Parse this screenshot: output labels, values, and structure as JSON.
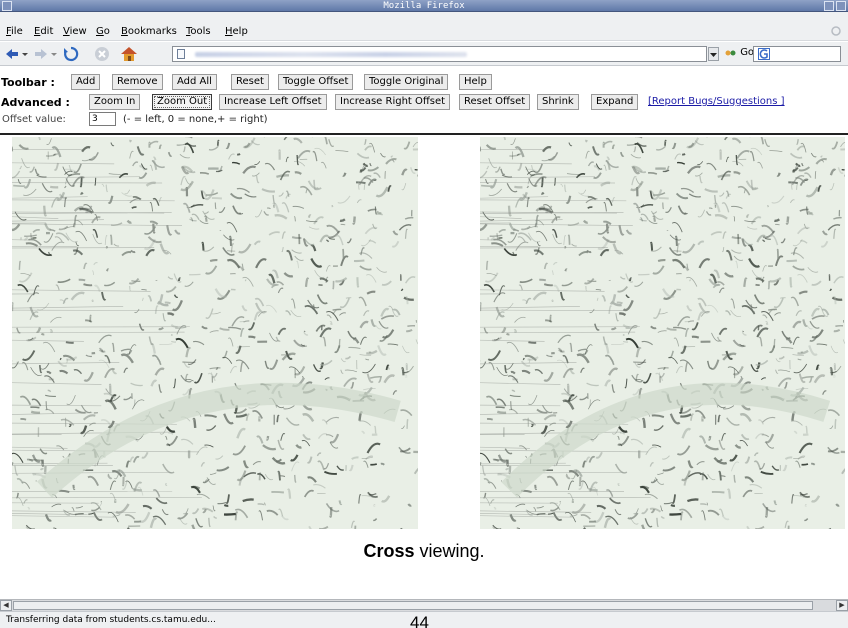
{
  "window": {
    "title": "Mozilla Firefox"
  },
  "menu": {
    "items": [
      {
        "label": "File",
        "key": "F",
        "rest": "ile"
      },
      {
        "label": "Edit",
        "key": "E",
        "rest": "dit"
      },
      {
        "label": "View",
        "key": "V",
        "rest": "iew"
      },
      {
        "label": "Go",
        "key": "G",
        "rest": "o"
      },
      {
        "label": "Bookmarks",
        "key": "B",
        "rest": "ookmarks"
      },
      {
        "label": "Tools",
        "key": "T",
        "rest": "ools"
      },
      {
        "label": "Help",
        "key": "H",
        "rest": "elp"
      }
    ]
  },
  "nav": {
    "go_label": "Go",
    "search_icon": "google-g-icon"
  },
  "toolbar": {
    "label": "Toolbar :",
    "buttons": [
      "Add",
      "Remove",
      "Add All",
      "Reset",
      "Toggle Offset",
      "Toggle Original",
      "Help"
    ]
  },
  "advanced": {
    "label": "Advanced :",
    "buttons": [
      "Zoom In",
      "Zoom Out",
      "Increase Left Offset",
      "Increase Right Offset",
      "Reset Offset",
      "Shrink",
      "Expand"
    ],
    "pressed": "Zoom Out",
    "report_link": "[Report Bugs/Suggestions ]"
  },
  "offset": {
    "label": "Offset value:",
    "value": "3",
    "hint": "(- = left, 0 = none,+ = right)"
  },
  "caption": {
    "bold": "Cross",
    "rest": " viewing."
  },
  "status": {
    "text": "Transferring data from students.cs.tamu.edu..."
  },
  "page_number": "44",
  "colors": {
    "titlebar": "#5f78a8",
    "link": "#1a1aa6",
    "chrome": "#eef0f2"
  }
}
